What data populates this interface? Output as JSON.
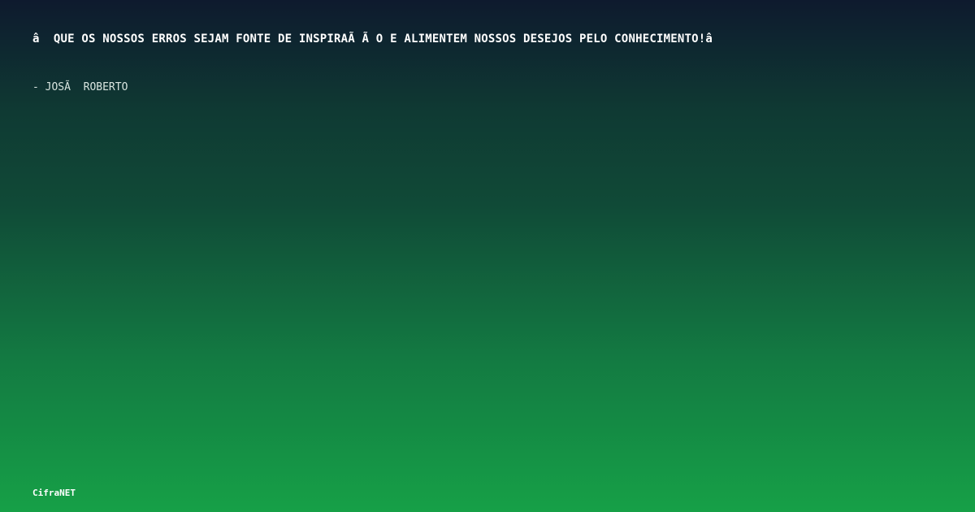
{
  "quote": {
    "text": "â  QUE OS NOSSOS ERROS SEJAM FONTE DE INSPIRAÃ Ã O E ALIMENTEM NOSSOS DESEJOS PELO CONHECIMENTO!â"
  },
  "author": {
    "text": "- JOSÃ  ROBERTO"
  },
  "brand": {
    "name": "CifraNET"
  },
  "colors": {
    "background_top": "#0e1a2e",
    "background_bottom": "#16a047",
    "text": "#ffffff"
  }
}
